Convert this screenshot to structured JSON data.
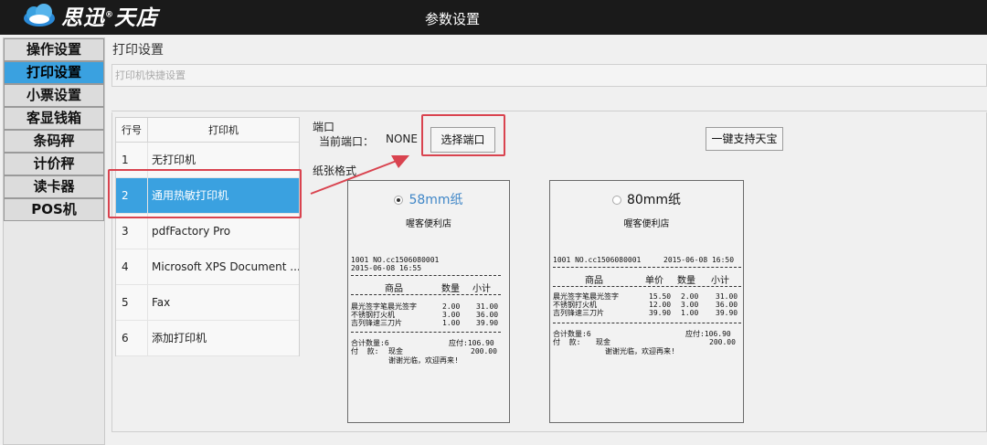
{
  "titlebar": {
    "logo_text": "思迅",
    "logo_reg": "®",
    "logo_text2": "天店",
    "title": "参数设置"
  },
  "sidebar": {
    "items": [
      "操作设置",
      "打印设置",
      "小票设置",
      "客显钱箱",
      "条码秤",
      "计价秤",
      "读卡器",
      "POS机"
    ],
    "active_index": 1
  },
  "main": {
    "section_title": "打印设置",
    "quick_setup": "打印机快捷设置",
    "printer_table": {
      "headers": [
        "行号",
        "打印机"
      ],
      "rows": [
        {
          "no": "1",
          "name": "无打印机"
        },
        {
          "no": "2",
          "name": "通用热敏打印机"
        },
        {
          "no": "3",
          "name": "pdfFactory Pro"
        },
        {
          "no": "4",
          "name": "Microsoft XPS Document ..."
        },
        {
          "no": "5",
          "name": "Fax"
        },
        {
          "no": "6",
          "name": "添加打印机"
        }
      ],
      "selected_index": 1
    },
    "port": {
      "label": "端口",
      "current_label": "当前端口：",
      "current_value": "NONE",
      "choose_button": "选择端口"
    },
    "onekey_button": "一键支持天宝",
    "paper": {
      "label": "纸张格式",
      "options": [
        {
          "label": "58mm纸",
          "selected": true
        },
        {
          "label": "80mm纸",
          "selected": false
        }
      ]
    },
    "receipt58": {
      "shop": "喔客便利店",
      "line1": "1001 NO.cc1506080001",
      "line2": "2015-06-08 16:55",
      "header": [
        "商品",
        "数量",
        "小计"
      ],
      "items": [
        [
          "晨光签字笔晨光签字",
          "2.00",
          "31.00"
        ],
        [
          "不锈钢打火机",
          "3.00",
          "36.00"
        ],
        [
          "吉列锋速三刀片",
          "1.00",
          "39.90"
        ]
      ],
      "total_qty": "合计数量:6",
      "due": "应付:106.90",
      "pay_label": "付  款:",
      "pay_method": "现金",
      "paid": "200.00",
      "thanks": "谢谢光临，欢迎再来!"
    },
    "receipt80": {
      "shop": "喔客便利店",
      "line1": "1001 NO.cc1506080001",
      "line1b": "2015-06-08 16:50",
      "header": [
        "商品",
        "单价",
        "数量",
        "小计"
      ],
      "items": [
        [
          "晨光签字笔晨光签字",
          "15.50",
          "2.00",
          "31.00"
        ],
        [
          "不锈钢打火机",
          "12.00",
          "3.00",
          "36.00"
        ],
        [
          "吉列锋速三刀片",
          "39.90",
          "1.00",
          "39.90"
        ]
      ],
      "total_qty": "合计数量:6",
      "due": "应付:106.90",
      "pay_label": "付  款:",
      "pay_method": "现金",
      "paid": "200.00",
      "thanks": "谢谢光临，欢迎再来!"
    }
  },
  "colors": {
    "accent": "#3aa1e0",
    "highlight": "#d9434f",
    "titlebar": "#1a1a1a"
  }
}
